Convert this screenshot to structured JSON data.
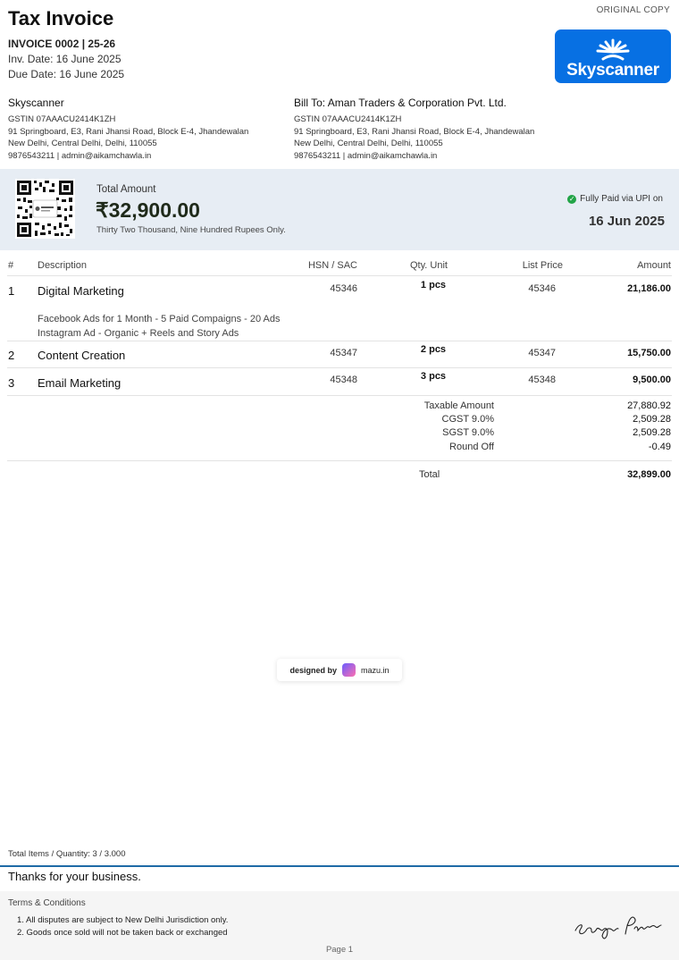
{
  "header": {
    "copy_label": "ORIGINAL COPY",
    "title": "Tax Invoice",
    "invoice_no": "INVOICE 0002 | 25-26",
    "inv_date": "Inv. Date: 16 June 2025",
    "due_date": "Due Date: 16 June 2025"
  },
  "logo": {
    "text": "Skyscanner",
    "color": "#0770e3"
  },
  "seller": {
    "name": "Skyscanner",
    "gstin": "GSTIN 07AAACU2414K1ZH",
    "address1": "91 Springboard, E3, Rani Jhansi Road, Block E-4, Jhandewalan",
    "address2": "New Delhi, Central Delhi, Delhi, 110055",
    "contact": "9876543211 | admin@aikamchawla.in"
  },
  "buyer": {
    "name": "Bill To: Aman Traders & Corporation Pvt. Ltd.",
    "gstin": "GSTIN 07AAACU2414K1ZH",
    "address1": "91 Springboard, E3, Rani Jhansi Road, Block E-4, Jhandewalan",
    "address2": "New Delhi, Central Delhi, Delhi, 110055",
    "contact": "9876543211 | admin@aikamchawla.in"
  },
  "total_band": {
    "label": "Total Amount",
    "amount": "₹32,900.00",
    "words": "Thirty Two Thousand, Nine Hundred Rupees Only.",
    "status": "Fully Paid via UPI on",
    "paid_date": "16 Jun 2025",
    "status_color": "#22a447",
    "band_color": "#e7edf4"
  },
  "table": {
    "headers": {
      "no": "#",
      "description": "Description",
      "hsn": "HSN / SAC",
      "qty": "Qty. Unit",
      "price": "List Price",
      "amount": "Amount"
    },
    "rows": [
      {
        "no": "1",
        "description": "Digital Marketing",
        "hsn": "45346",
        "qty": "1 pcs",
        "price": "45346",
        "amount": "21,186.00",
        "details": [
          "Facebook Ads for 1 Month - 5 Paid Compaigns - 20 Ads",
          "Instagram Ad - Organic + Reels and Story Ads"
        ]
      },
      {
        "no": "2",
        "description": "Content Creation",
        "hsn": "45347",
        "qty": "2 pcs",
        "price": "45347",
        "amount": "15,750.00"
      },
      {
        "no": "3",
        "description": "Email Marketing",
        "hsn": "45348",
        "qty": "3 pcs",
        "price": "45348",
        "amount": "9,500.00"
      }
    ]
  },
  "summary": {
    "taxable_label": "Taxable Amount",
    "taxable_value": "27,880.92",
    "cgst_label": "CGST 9.0%",
    "cgst_value": "2,509.28",
    "sgst_label": "SGST 9.0%",
    "sgst_value": "2,509.28",
    "round_label": "Round Off",
    "round_value": "-0.49",
    "total_label": "Total",
    "total_value": "32,899.00"
  },
  "badge": {
    "prefix": "designed by",
    "brand": "mazu.in"
  },
  "footer": {
    "total_items": "Total Items / Quantity: 3 / 3.000",
    "thanks": "Thanks for your business.",
    "terms_title": "Terms & Conditions",
    "terms": [
      "1. All disputes are subject to New Delhi Jurisdiction only.",
      "2. Goods once sold will not be taken back or exchanged"
    ],
    "signature": "Sanjay Puri",
    "page": "Page 1",
    "accent_color": "#1f6aa6"
  }
}
